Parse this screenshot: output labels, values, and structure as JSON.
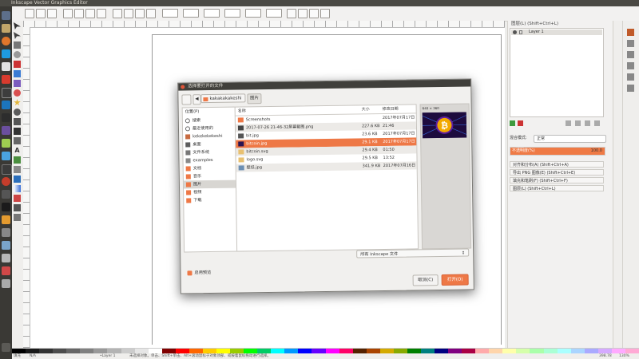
{
  "window": {
    "title": "Inkscape Vector Graphics Editor"
  },
  "dock": {
    "layers_header": "图层(L) (Shift+Ctrl+L)",
    "layer_name": "Layer 1",
    "blend_label": "混合模式:",
    "blend_value": "正常",
    "opacity_label": "不透明度(%)",
    "opacity_value": "100.0",
    "panels": [
      "对齐和分布(A) (Shift+Ctrl+A)",
      "导出 PNG 图像(E) (Shift+Ctrl+E)",
      "填充和笔刷(F) (Shift+Ctrl+F)",
      "图层(L) (Shift+Ctrl+L)"
    ]
  },
  "status": {
    "fill_label": "填充",
    "stroke_label": "笔刷",
    "fill_value": "N/A",
    "layer": "•Layer 1",
    "message": "未选择对象。单击、Shift+单击、Alt+滚动鼠标于对象顶部、或按着鼠标拖动进行选择。",
    "x": "398.78",
    "y": "306.81",
    "zoom": "130%"
  },
  "dialog": {
    "title": "选择要打开的文件",
    "path_user": "kakakakakeshi",
    "path_current": "图片",
    "places_header": "位置(P)",
    "places": [
      {
        "label": "搜索",
        "icon": "search-icon"
      },
      {
        "label": "最近使用的",
        "icon": "clock-icon"
      },
      {
        "label": "kekekekekeshi",
        "icon": "home-icon"
      },
      {
        "label": "桌面",
        "icon": "desktop-icon"
      },
      {
        "label": "文件系统",
        "icon": "drive-icon"
      },
      {
        "label": "examples",
        "icon": "folder-icon"
      },
      {
        "label": "文档",
        "icon": "folder-icon"
      },
      {
        "label": "音乐",
        "icon": "music-icon"
      },
      {
        "label": "图片",
        "icon": "picture-icon",
        "selected": true
      },
      {
        "label": "视频",
        "icon": "video-icon"
      },
      {
        "label": "下载",
        "icon": "download-icon"
      }
    ],
    "columns": {
      "name": "名称",
      "size": "大小",
      "modified": "修改日期"
    },
    "files": [
      {
        "name": "Screenshots",
        "size": "",
        "modified": "2017年07月17日",
        "type": "folder"
      },
      {
        "name": "2017-07-26 21-46-32屏幕截图.png",
        "size": "227.6 KB",
        "modified": "21:46",
        "type": "image"
      },
      {
        "name": "bit.jpg",
        "size": "23.6 KB",
        "modified": "2017年07月17日",
        "type": "image"
      },
      {
        "name": "bitcoin.jpg",
        "size": "29.1 KB",
        "modified": "2017年07月17日",
        "type": "image",
        "selected": true
      },
      {
        "name": "bitcoin.svg",
        "size": "29.4 KB",
        "modified": "01:50",
        "type": "svg"
      },
      {
        "name": "logo.svg",
        "size": "29.5 KB",
        "modified": "13:52",
        "type": "svg"
      },
      {
        "name": "壁纸.jpg",
        "size": "341.9 KB",
        "modified": "2017年07月16日",
        "type": "image"
      }
    ],
    "preview_caption": "640 × 360",
    "filter": "所有 Inkscape 文件",
    "enable_preview": "启用预览",
    "cancel": "取消(C)",
    "open": "打开(O)"
  },
  "colors": {
    "accent": "#ee7846",
    "titlebar": "#4a4944",
    "launcher": "#3a3935"
  }
}
